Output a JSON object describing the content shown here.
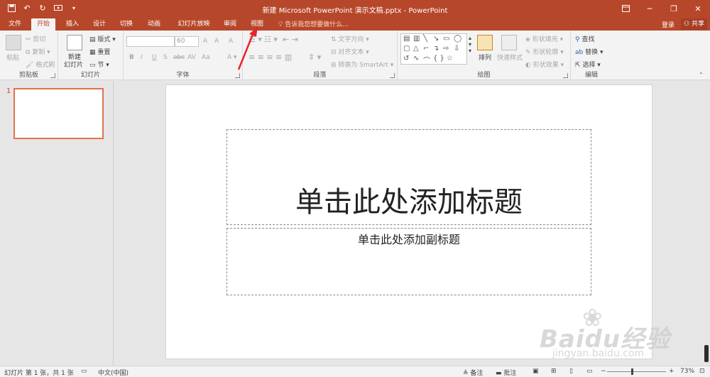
{
  "window": {
    "title": "新建 Microsoft PowerPoint 演示文稿.pptx - PowerPoint",
    "quick_access": [
      "save-icon",
      "undo-icon",
      "redo-icon",
      "start-from-beginning-icon",
      "customize-icon"
    ],
    "controls": [
      "ribbon-display-icon",
      "minimize-icon",
      "restore-icon",
      "close-icon"
    ]
  },
  "tabs": [
    {
      "label": "文件"
    },
    {
      "label": "开始"
    },
    {
      "label": "插入"
    },
    {
      "label": "设计"
    },
    {
      "label": "切换"
    },
    {
      "label": "动画"
    },
    {
      "label": "幻灯片放映"
    },
    {
      "label": "审阅"
    },
    {
      "label": "视图"
    }
  ],
  "active_tab": "开始",
  "tell_me": "告诉我您想要做什么...",
  "account": {
    "login": "登录",
    "share": "共享"
  },
  "ribbon": {
    "clipboard": {
      "label": "剪贴板",
      "paste": "粘贴",
      "cut": "剪切",
      "copy": "复制",
      "format_painter": "格式刷"
    },
    "slides": {
      "label": "幻灯片",
      "new_slide_1": "新建",
      "new_slide_2": "幻灯片",
      "layout": "版式",
      "reset": "重置",
      "section": "节"
    },
    "font": {
      "label": "字体",
      "font_name": "",
      "font_size": "60",
      "bold": "B",
      "italic": "I",
      "underline": "U",
      "shadow": "S",
      "strike": "abc",
      "spacing": "AV",
      "case": "Aa",
      "grow": "A",
      "shrink": "A",
      "clear": "A"
    },
    "paragraph": {
      "label": "段落",
      "text_direction": "文字方向",
      "align_text": "对齐文本",
      "smartart": "转换为 SmartArt"
    },
    "drawing": {
      "label": "绘图",
      "arrange": "排列",
      "quick_styles": "快速样式",
      "fill": "形状填充",
      "outline": "形状轮廓",
      "effects": "形状效果"
    },
    "editing": {
      "label": "编辑",
      "find": "查找",
      "replace": "替换",
      "select": "选择"
    }
  },
  "thumbnail": {
    "number": "1"
  },
  "slide": {
    "title_placeholder": "单击此处添加标题",
    "subtitle_placeholder": "单击此处添加副标题"
  },
  "watermark": {
    "brand": "Baidu经验",
    "url": "jingyan.baidu.com"
  },
  "status": {
    "slide_info": "幻灯片 第 1 张，共 1 张",
    "language": "中文(中国)",
    "notes": "备注",
    "comments": "批注",
    "zoom": "73%"
  },
  "colors": {
    "accent": "#b7472a",
    "ribbon_bg": "#f3f3f3",
    "thumb_border": "#e2704d",
    "annotation": "#e8232a"
  }
}
